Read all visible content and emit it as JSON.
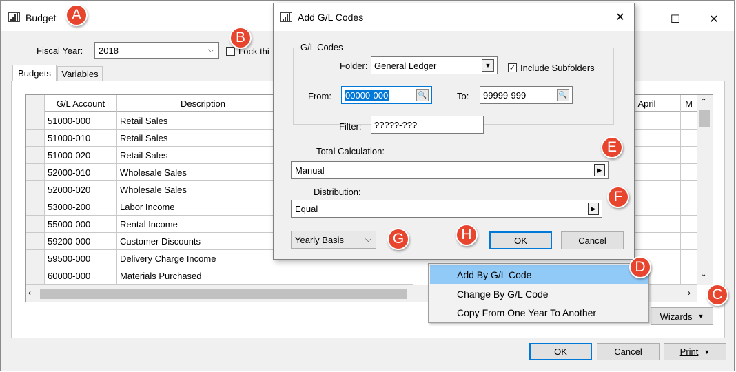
{
  "main_window": {
    "title": "Budget",
    "fiscal_year_label": "Fiscal Year:",
    "fiscal_year_value": "2018",
    "lock_label": "Lock thi",
    "tabs": [
      "Budgets",
      "Variables"
    ],
    "grid": {
      "headers": {
        "gl_account": "G/L Account",
        "description": "Description",
        "april": "April",
        "trunc": "M"
      },
      "rows": [
        {
          "account": "51000-000",
          "description": "Retail Sales"
        },
        {
          "account": "51000-010",
          "description": "Retail Sales"
        },
        {
          "account": "51000-020",
          "description": "Retail Sales"
        },
        {
          "account": "52000-010",
          "description": "Wholesale Sales"
        },
        {
          "account": "52000-020",
          "description": "Wholesale Sales"
        },
        {
          "account": "53000-200",
          "description": "Labor Income"
        },
        {
          "account": "55000-000",
          "description": "Rental Income"
        },
        {
          "account": "59200-000",
          "description": "Customer Discounts"
        },
        {
          "account": "59500-000",
          "description": "Delivery Charge Income"
        },
        {
          "account": "60000-000",
          "description": "Materials Purchased"
        }
      ]
    },
    "buttons": {
      "wizards": "Wizards",
      "ok": "OK",
      "cancel": "Cancel",
      "print": "Print"
    }
  },
  "context_menu": {
    "items": [
      "Add By G/L Code",
      "Change By G/L Code",
      "Copy From One Year To Another"
    ]
  },
  "dialog": {
    "title": "Add G/L Codes",
    "group_label": "G/L Codes",
    "folder_label": "Folder:",
    "folder_value": "General Ledger",
    "include_subfolders_label": "Include Subfolders",
    "from_label": "From:",
    "from_value": "00000-000",
    "to_label": "To:",
    "to_value": "99999-999",
    "filter_label": "Filter:",
    "filter_value": "?????-???",
    "total_calc_label": "Total Calculation:",
    "total_calc_value": "Manual",
    "distribution_label": "Distribution:",
    "distribution_value": "Equal",
    "basis_value": "Yearly Basis",
    "ok": "OK",
    "cancel": "Cancel"
  },
  "badges": {
    "a": "A",
    "b": "B",
    "c": "C",
    "d": "D",
    "e": "E",
    "f": "F",
    "g": "G",
    "h": "H"
  },
  "colors": {
    "badge": "#e8452f",
    "menu_highlight": "#91c9f7",
    "focus_blue": "#0078d7"
  }
}
